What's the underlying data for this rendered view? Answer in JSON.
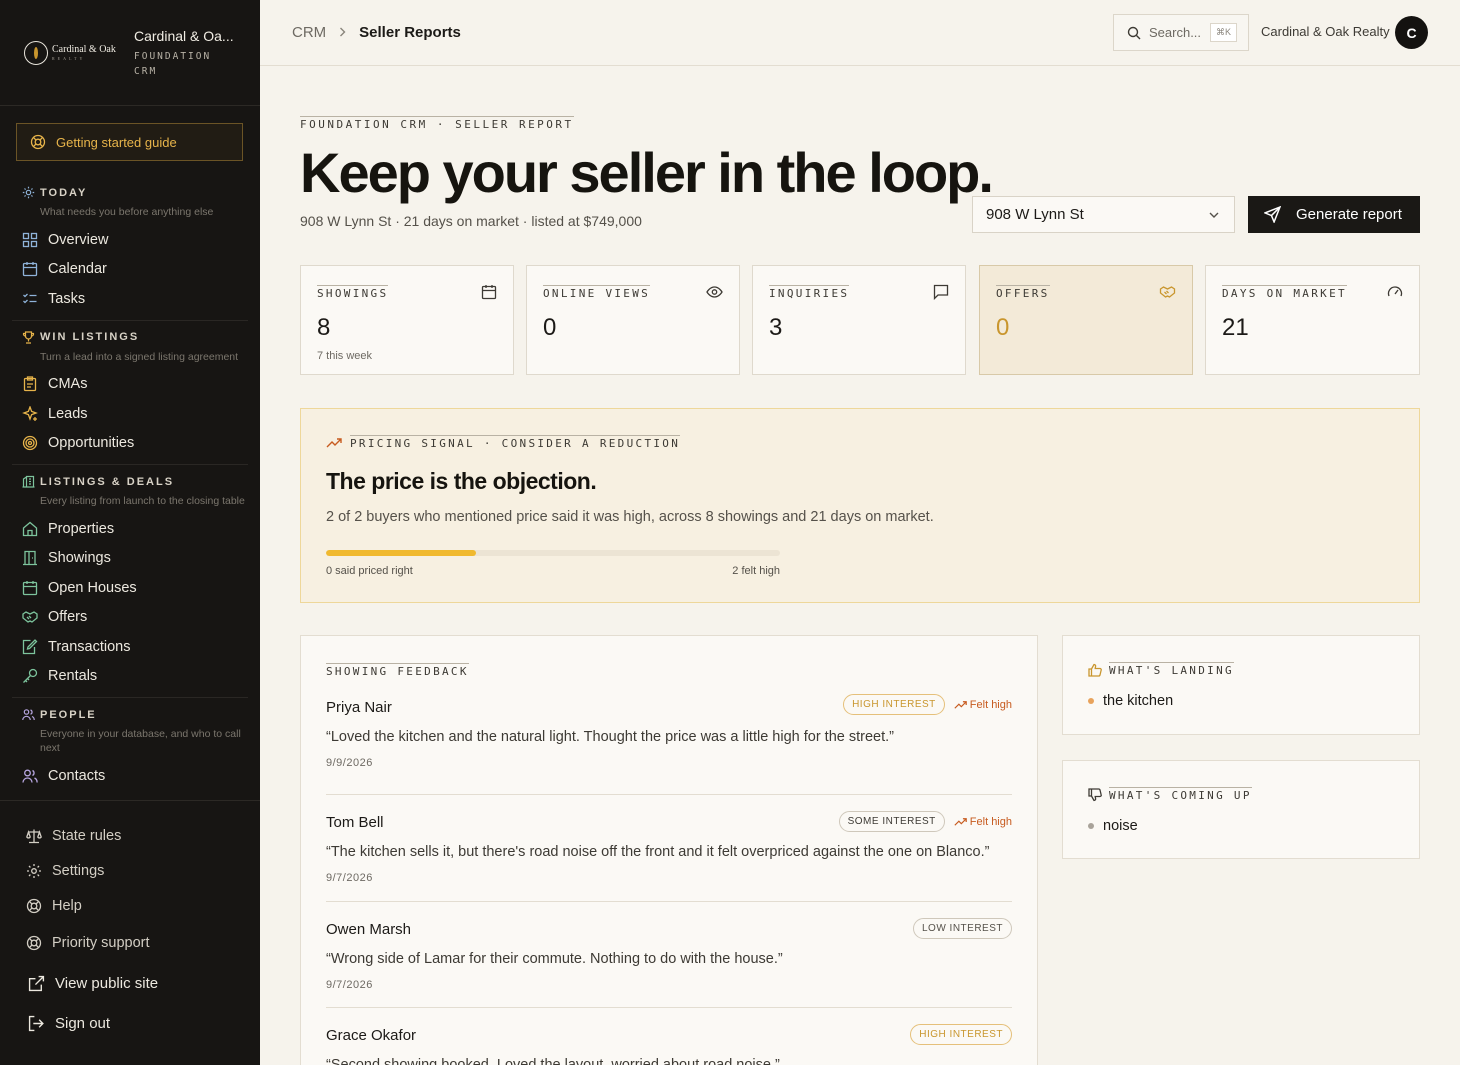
{
  "brand": {
    "logo_line1": "Cardinal & Oak",
    "logo_line2": "REALTY",
    "name": "Cardinal & Oa...",
    "sub": "FOUNDATION CRM"
  },
  "guide_label": "Getting started guide",
  "nav": {
    "today": {
      "title": "TODAY",
      "desc": "What needs you before anything else",
      "items": [
        "Overview",
        "Calendar",
        "Tasks"
      ]
    },
    "win": {
      "title": "WIN LISTINGS",
      "desc": "Turn a lead into a signed listing agreement",
      "items": [
        "CMAs",
        "Leads",
        "Opportunities"
      ]
    },
    "deals": {
      "title": "LISTINGS & DEALS",
      "desc": "Every listing from launch to the closing table",
      "items": [
        "Properties",
        "Showings",
        "Open Houses",
        "Offers",
        "Transactions",
        "Rentals"
      ]
    },
    "people": {
      "title": "PEOPLE",
      "desc": "Everyone in your database, and who to call next",
      "items": [
        "Contacts"
      ]
    }
  },
  "bottom_nav": [
    "State rules",
    "Settings",
    "Help",
    "Priority support",
    "View public site",
    "Sign out"
  ],
  "topbar": {
    "crumb_root": "CRM",
    "crumb_current": "Seller Reports",
    "search_placeholder": "Search...",
    "search_kbd": "⌘K",
    "org": "Cardinal & Oak Realty",
    "avatar_initial": "C"
  },
  "header": {
    "eyebrow": "FOUNDATION CRM · SELLER REPORT",
    "title": "Keep your seller in the loop.",
    "subtitle": "908 W Lynn St · 21 days on market · listed at $749,000",
    "property_select": "908 W Lynn St",
    "generate_label": "Generate report"
  },
  "metrics": [
    {
      "label": "SHOWINGS",
      "value": "8",
      "note": "7 this week",
      "icon": "calendar-icon"
    },
    {
      "label": "ONLINE VIEWS",
      "value": "0",
      "note": "",
      "icon": "eye-icon"
    },
    {
      "label": "INQUIRIES",
      "value": "3",
      "note": "",
      "icon": "message-icon"
    },
    {
      "label": "OFFERS",
      "value": "0",
      "note": "",
      "icon": "handshake-icon"
    },
    {
      "label": "DAYS ON MARKET",
      "value": "21",
      "note": "",
      "icon": "gauge-icon"
    }
  ],
  "signal": {
    "eyebrow": "PRICING SIGNAL · CONSIDER A REDUCTION",
    "title": "The price is the objection.",
    "text": "2 of 2 buyers who mentioned price said it was high, across 8 showings and 21 days on market.",
    "left_label": "0 said priced right",
    "right_label": "2 felt high",
    "fill_fraction": 0.33
  },
  "feedback": {
    "eyebrow": "SHOWING FEEDBACK",
    "rows": [
      {
        "name": "Priya Nair",
        "interest": "HIGH INTEREST",
        "felt": "Felt high",
        "quote": "“Loved the kitchen and the natural light. Thought the price was a little high for the street.”",
        "date": "9/9/2026"
      },
      {
        "name": "Tom Bell",
        "interest": "SOME INTEREST",
        "felt": "Felt high",
        "quote": "“The kitchen sells it, but there's road noise off the front and it felt overpriced against the one on Blanco.”",
        "date": "9/7/2026"
      },
      {
        "name": "Owen Marsh",
        "interest": "LOW INTEREST",
        "felt": "",
        "quote": "“Wrong side of Lamar for their commute. Nothing to do with the house.”",
        "date": "9/7/2026"
      },
      {
        "name": "Grace Okafor",
        "interest": "HIGH INTEREST",
        "felt": "",
        "quote": "“Second showing booked. Loved the layout, worried about road noise.”",
        "date": ""
      }
    ]
  },
  "landing": {
    "eyebrow": "WHAT'S LANDING",
    "items": [
      "the kitchen"
    ]
  },
  "coming": {
    "eyebrow": "WHAT'S COMING UP",
    "items": [
      "noise"
    ]
  },
  "colors": {
    "accent": "#c9962e",
    "alert": "#c75b1f",
    "sidebar": "#171513",
    "page": "#f6f3ec"
  }
}
